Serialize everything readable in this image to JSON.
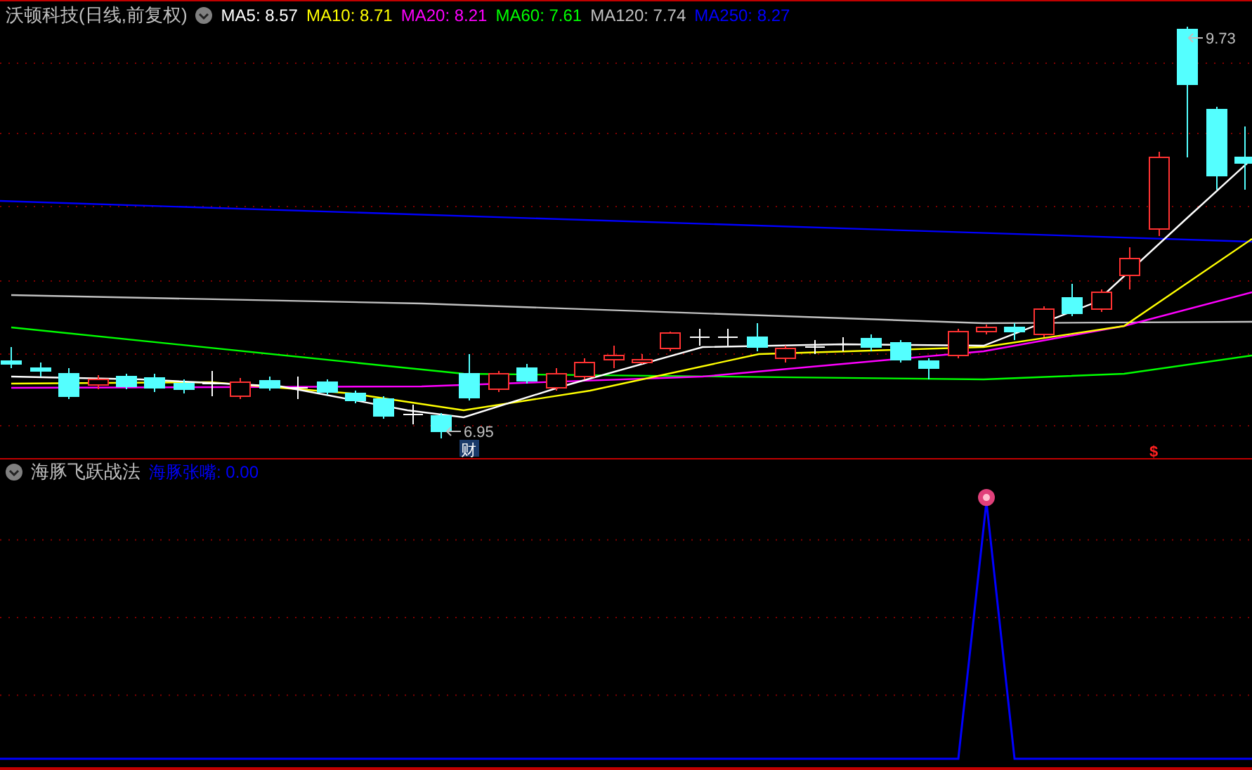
{
  "price_panel": {
    "title": "沃顿科技(日线,前复权)",
    "moving_averages": [
      {
        "label": "MA5: 8.57",
        "color": "#ffffff"
      },
      {
        "label": "MA10: 8.71",
        "color": "#ffff00"
      },
      {
        "label": "MA20: 8.21",
        "color": "#ff00ff"
      },
      {
        "label": "MA60: 7.61",
        "color": "#00ff00"
      },
      {
        "label": "MA120: 7.74",
        "color": "#c0c0c0"
      },
      {
        "label": "MA250: 8.27",
        "color": "#0000ff"
      }
    ],
    "high_label": "9.73",
    "low_label": "6.95",
    "report_marker": "财",
    "signal_marker": "$"
  },
  "indicator_panel": {
    "title": "海豚飞跃战法",
    "series_label": "海豚张嘴: 0.00"
  }
}
